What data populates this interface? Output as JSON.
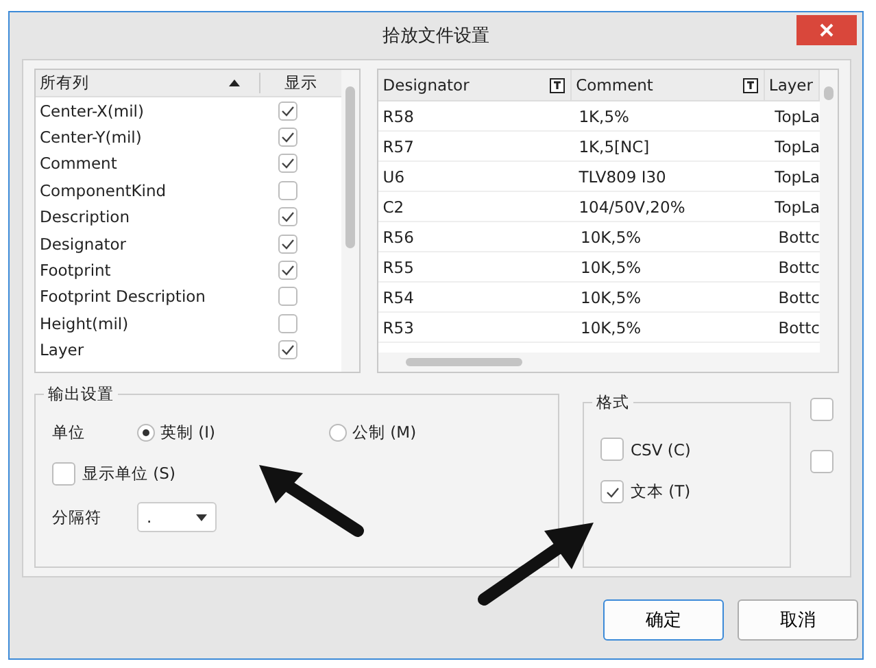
{
  "window": {
    "title": "拾放文件设置"
  },
  "column_list": {
    "header": "所有列",
    "show_header": "显示",
    "items": [
      {
        "label": "Center-X(mil)",
        "checked": true
      },
      {
        "label": "Center-Y(mil)",
        "checked": true
      },
      {
        "label": "Comment",
        "checked": true
      },
      {
        "label": "ComponentKind",
        "checked": false
      },
      {
        "label": "Description",
        "checked": true
      },
      {
        "label": "Designator",
        "checked": true
      },
      {
        "label": "Footprint",
        "checked": true
      },
      {
        "label": "Footprint Description",
        "checked": false
      },
      {
        "label": "Height(mil)",
        "checked": false
      },
      {
        "label": "Layer",
        "checked": true
      }
    ]
  },
  "table": {
    "columns": [
      "Designator",
      "Comment",
      "Layer"
    ],
    "rows": [
      [
        "R58",
        "1K,5%",
        "TopLa"
      ],
      [
        "R57",
        "1K,5[NC]",
        "TopLa"
      ],
      [
        "U6",
        "TLV809 I30",
        "TopLa"
      ],
      [
        "C2",
        "104/50V,20%",
        "TopLa"
      ],
      [
        "R56",
        "10K,5%",
        "Bottc"
      ],
      [
        "R55",
        "10K,5%",
        "Bottc"
      ],
      [
        "R54",
        "10K,5%",
        "Bottc"
      ],
      [
        "R53",
        "10K,5%",
        "Bottc"
      ]
    ]
  },
  "output_settings": {
    "title": "输出设置",
    "unit_label": "单位",
    "units": [
      {
        "label": "英制 (I)",
        "selected": true
      },
      {
        "label": "公制 (M)",
        "selected": false
      }
    ],
    "show_units": {
      "label": "显示单位 (S)",
      "checked": false
    },
    "separator_label": "分隔符",
    "separator": "."
  },
  "format": {
    "title": "格式",
    "options": [
      {
        "label": "CSV (C)",
        "checked": false
      },
      {
        "label": "文本 (T)",
        "checked": true
      }
    ]
  },
  "extra_options": [
    {
      "checked": false
    },
    {
      "checked": false
    }
  ],
  "buttons": [
    {
      "label": "确定",
      "kind": "default"
    },
    {
      "label": "取消",
      "kind": "normal"
    }
  ]
}
